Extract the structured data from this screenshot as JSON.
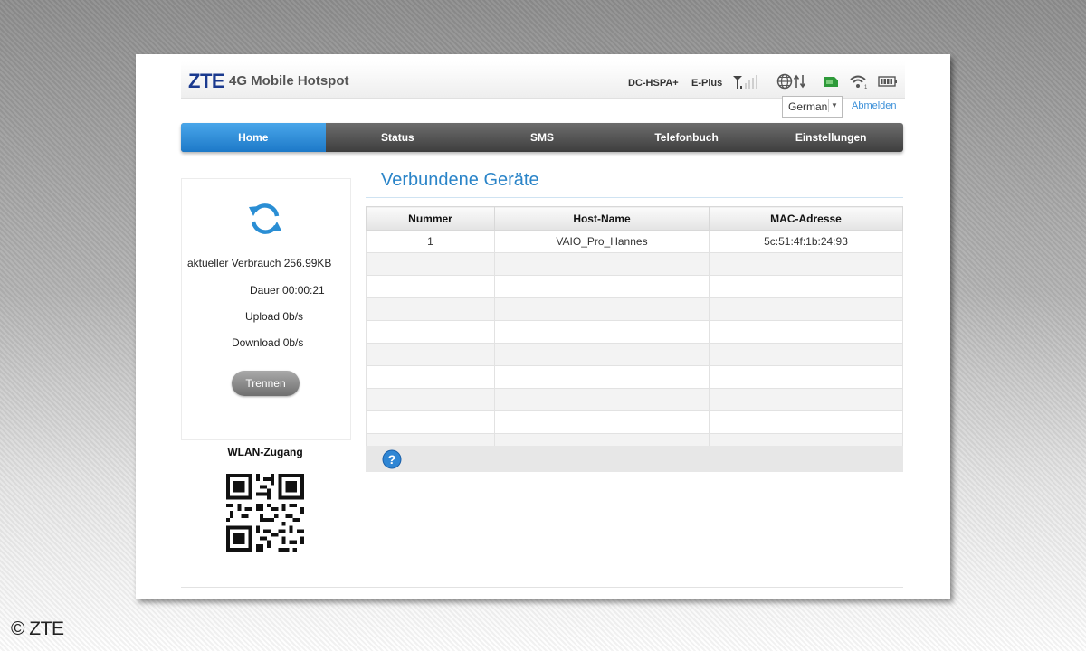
{
  "copyright": "© ZTE",
  "header": {
    "logo": "ZTE",
    "product": "4G Mobile Hotspot",
    "network_type": "DC-HSPA+",
    "provider": "E-Plus",
    "icons": [
      "signal-strength-icon",
      "internet-connection-icon",
      "sim-card-icon",
      "wifi-icon",
      "battery-icon"
    ]
  },
  "language": {
    "selected": "German"
  },
  "logout_label": "Abmelden",
  "nav": {
    "items": [
      {
        "label": "Home",
        "active": true
      },
      {
        "label": "Status",
        "active": false
      },
      {
        "label": "SMS",
        "active": false
      },
      {
        "label": "Telefonbuch",
        "active": false
      },
      {
        "label": "Einstellungen",
        "active": false
      }
    ]
  },
  "connection": {
    "usage": "aktueller Verbrauch 256.99KB",
    "duration": "Dauer 00:00:21",
    "upload": "Upload 0b/s",
    "download": "Download 0b/s",
    "disconnect_label": "Trennen"
  },
  "wlan": {
    "title": "WLAN-Zugang"
  },
  "devices": {
    "title": "Verbundene Geräte",
    "columns": [
      "Nummer",
      "Host-Name",
      "MAC-Adresse"
    ],
    "rows": [
      [
        "1",
        "VAIO_Pro_Hannes",
        "5c:51:4f:1b:24:93"
      ],
      [
        "",
        "",
        ""
      ],
      [
        "",
        "",
        ""
      ],
      [
        "",
        "",
        ""
      ],
      [
        "",
        "",
        ""
      ],
      [
        "",
        "",
        ""
      ],
      [
        "",
        "",
        ""
      ],
      [
        "",
        "",
        ""
      ],
      [
        "",
        "",
        ""
      ],
      [
        "",
        "",
        ""
      ]
    ]
  },
  "colors": {
    "accent": "#2a84c8",
    "nav_dark": "#4a4a4a",
    "nav_active": "#2f8fdd",
    "logo": "#1b3a8f",
    "sim": "#2e9a3a"
  }
}
